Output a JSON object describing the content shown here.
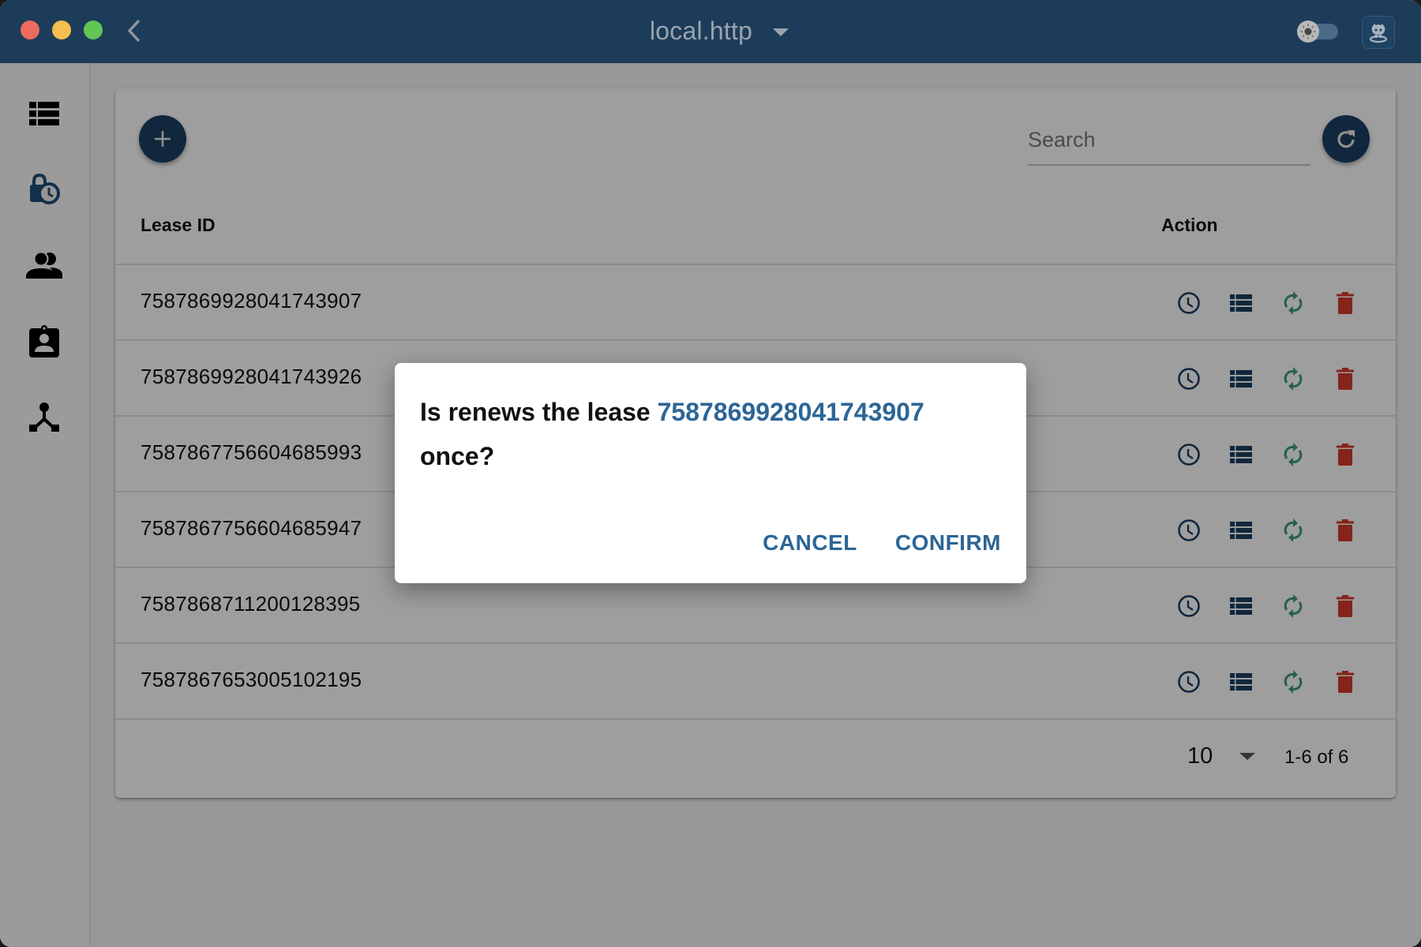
{
  "titlebar": {
    "title": "local.http",
    "colors": {
      "background": "#1c3c5a"
    }
  },
  "sidebar": {
    "items": [
      {
        "name": "list",
        "icon": "view-list-icon",
        "active": false
      },
      {
        "name": "leases",
        "icon": "lock-clock-icon",
        "active": true
      },
      {
        "name": "users",
        "icon": "group-icon",
        "active": false
      },
      {
        "name": "roles",
        "icon": "badge-icon",
        "active": false
      },
      {
        "name": "cluster",
        "icon": "hub-icon",
        "active": false
      }
    ]
  },
  "toolbar": {
    "search_placeholder": "Search",
    "search_value": ""
  },
  "table": {
    "columns": [
      "Lease ID",
      "Action"
    ],
    "rows": [
      {
        "lease_id": "7587869928041743907"
      },
      {
        "lease_id": "7587869928041743926"
      },
      {
        "lease_id": "7587867756604685993"
      },
      {
        "lease_id": "7587867756604685947"
      },
      {
        "lease_id": "7587868711200128395"
      },
      {
        "lease_id": "7587867653005102195"
      }
    ],
    "row_actions": [
      "time-to-live-icon",
      "list-keys-icon",
      "keep-alive-icon",
      "delete-icon"
    ]
  },
  "pagination": {
    "rows_per_page": "10",
    "range": "1-6 of 6"
  },
  "dialog": {
    "message_prefix": "Is renews the lease ",
    "lease_id": "7587869928041743907",
    "message_suffix": " once?",
    "cancel_label": "CANCEL",
    "confirm_label": "CONFIRM"
  },
  "colors": {
    "primary": "#1c3f63",
    "accent_text": "#2c6596",
    "renew": "#3f9a85",
    "delete": "#d63a2c"
  }
}
